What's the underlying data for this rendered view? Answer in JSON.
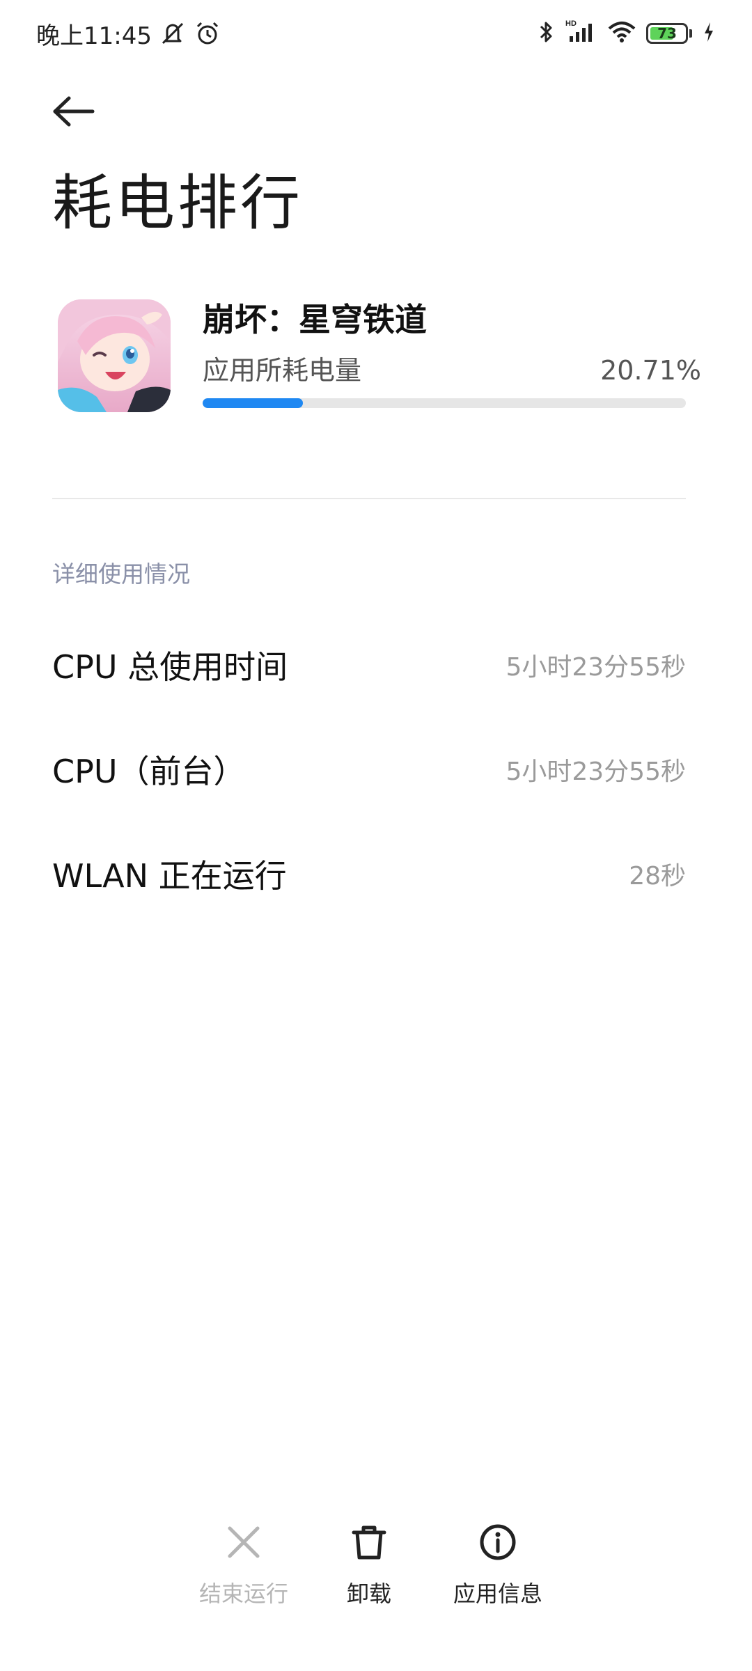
{
  "status_bar": {
    "time": "晚上11:45",
    "battery_level": "73",
    "battery_fraction": 0.73,
    "icons": [
      "mute-icon",
      "alarm-icon",
      "bluetooth-icon",
      "hd-signal-icon",
      "wifi-icon",
      "battery-icon",
      "charging-icon"
    ]
  },
  "header": {
    "back_icon": "back-arrow-icon",
    "title": "耗电排行"
  },
  "app": {
    "name": "崩坏：星穹铁道",
    "usage_label": "应用所耗电量",
    "usage_value": "20.71%",
    "usage_fraction": 0.2071,
    "accent_color": "#1f88f2"
  },
  "details": {
    "section_title": "详细使用情况",
    "rows": [
      {
        "label": "CPU 总使用时间",
        "value": "5小时23分55秒"
      },
      {
        "label": "CPU（前台）",
        "value": "5小时23分55秒"
      },
      {
        "label": "WLAN 正在运行",
        "value": "28秒"
      }
    ]
  },
  "actions": {
    "end": {
      "label": "结束运行",
      "icon": "close-icon",
      "enabled": false
    },
    "uninstall": {
      "label": "卸载",
      "icon": "trash-icon",
      "enabled": true
    },
    "info": {
      "label": "应用信息",
      "icon": "info-icon",
      "enabled": true
    }
  }
}
